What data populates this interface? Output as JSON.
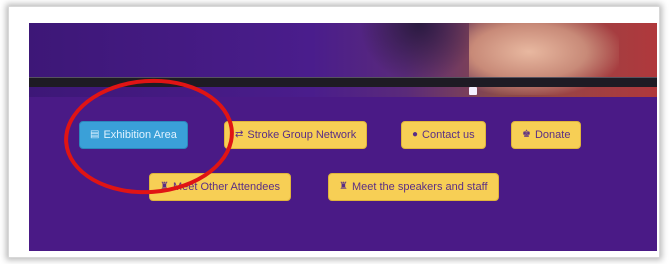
{
  "buttons": {
    "exhibition_area": "Exhibition Area",
    "stroke_group_network": "Stroke Group Network",
    "contact_us": "Contact us",
    "donate": "Donate",
    "meet_other_attendees": "Meet Other Attendees",
    "meet_speakers_staff": "Meet the speakers and staff"
  },
  "icons": {
    "exhibition": "calendar-icon",
    "stroke_group": "network-icon",
    "contact": "envelope-icon",
    "donate": "donate-icon",
    "attendees": "users-icon",
    "speakers": "users-icon"
  },
  "colors": {
    "panel_bg": "#4a1a86",
    "button_bg": "#f7cf55",
    "button_text": "#5a2e86",
    "active_button_bg": "#3aa0d8",
    "highlight_circle": "#e01414"
  }
}
